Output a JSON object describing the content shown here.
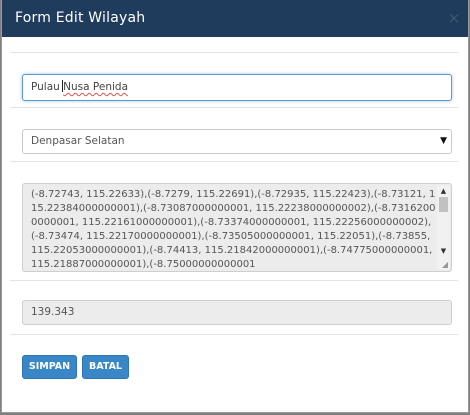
{
  "modal": {
    "title": "Form Edit Wilayah",
    "close_glyph": "×"
  },
  "form": {
    "name_field": {
      "before_caret": "Pulau ",
      "after_caret": "Nusa Penida",
      "value": "Pulau Nusa Penida"
    },
    "district_select": {
      "selected": "Denpasar Selatan",
      "arrow_icon": "▼"
    },
    "coordinates_textarea": {
      "value": "(-8.72743, 115.22633),(-8.7279, 115.22691),(-8.72935, 115.22423),(-8.73121, 115.22384000000001),(-8.73087000000001, 115.22238000000002),(-8.73162000000001, 115.22161000000001),(-8.73374000000001, 115.22256000000002),(-8.73474, 115.22170000000001),(-8.73505000000001, 115.22051),(-8.73855, 115.22053000000001),(-8.74413, 115.21842000000001),(-8.74775000000001, 115.21887000000001),(-8.75000000000001",
      "scroll_up_icon": "▲",
      "scroll_down_icon": "▼",
      "resize_icon": "◢"
    },
    "area_field": {
      "value": "139.343"
    }
  },
  "buttons": {
    "save_label": "SIMPAN",
    "cancel_label": "BATAL"
  },
  "colors": {
    "header_bg": "#1f3c5d",
    "button_bg": "#3a87c8",
    "focus_border": "#5b9bd5",
    "readonly_bg": "#ececec"
  }
}
